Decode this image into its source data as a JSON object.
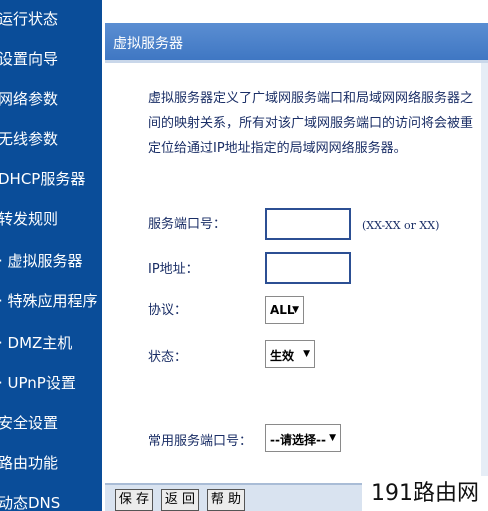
{
  "sidebar": {
    "items": [
      {
        "label": "运行状态"
      },
      {
        "label": "设置向导"
      },
      {
        "label": "网络参数"
      },
      {
        "label": "无线参数"
      },
      {
        "label": "DHCP服务器"
      },
      {
        "label": "转发规则"
      },
      {
        "label": "· 虚拟服务器"
      },
      {
        "label": "· 特殊应用程序"
      },
      {
        "label": "· DMZ主机"
      },
      {
        "label": "· UPnP设置"
      },
      {
        "label": "安全设置"
      },
      {
        "label": "路由功能"
      },
      {
        "label": "动态DNS"
      }
    ]
  },
  "panel": {
    "title": "虚拟服务器",
    "description": "虚拟服务器定义了广域网服务端口和局域网网络服务器之间的映射关系，所有对该广域网服务端口的访问将会被重定位给通过IP地址指定的局域网网络服务器。",
    "fields": {
      "service_port_label": "服务端口号：",
      "service_port_value": "",
      "service_port_hint": "(XX-XX or XX)",
      "ip_label": "IP地址：",
      "ip_value": "",
      "protocol_label": "协议：",
      "protocol_value": "ALL",
      "status_label": "状态：",
      "status_value": "生效",
      "common_port_label": "常用服务端口号：",
      "common_port_value": "--请选择--"
    },
    "buttons": {
      "save": "保 存",
      "back": "返 回",
      "help": "帮 助"
    }
  },
  "watermark": "191路由网",
  "colors": {
    "sidebar_bg": "#0a4d99",
    "title_bar": "#4a82cb",
    "text": "#1a2e66"
  }
}
